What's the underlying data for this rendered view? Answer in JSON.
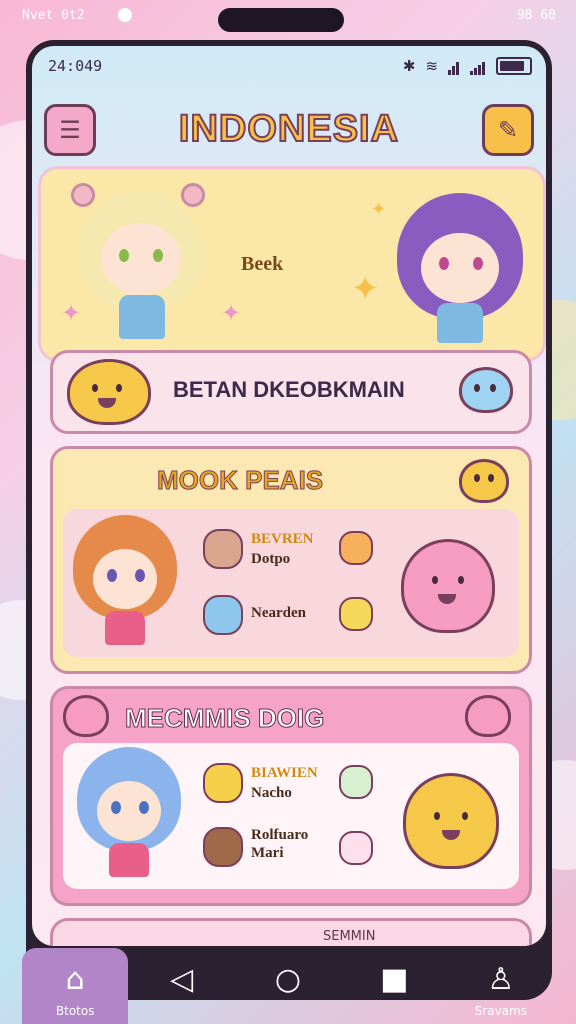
{
  "device": {
    "outer_status_left": "Nvet 0t2",
    "outer_status_right": "98 60"
  },
  "status_bar": {
    "time": "24:049"
  },
  "app_bar": {
    "title": "INDONESIA",
    "menu_icon": "menu-icon",
    "edit_icon": "edit-icon"
  },
  "hero": {
    "label": "Beek"
  },
  "banner": {
    "label": "BETAN DKEOBKMAIN"
  },
  "section1": {
    "title": "MOOK PEAIS",
    "items": [
      "BEVREN",
      "Dotpo",
      "Nearden"
    ]
  },
  "section2": {
    "title": "MECMMIS DOIG",
    "items": [
      "BIAWIEN",
      "Nacho",
      "Rolfuaro",
      "Mari"
    ]
  },
  "peek": {
    "label": "SEMMIN"
  },
  "bottom_nav": [
    {
      "label": "Btotos",
      "icon": "home-icon"
    },
    {
      "label": "",
      "icon": "back-icon"
    },
    {
      "label": "",
      "icon": "home-circle-icon"
    },
    {
      "label": "",
      "icon": "recents-icon"
    },
    {
      "label": "Sravams",
      "icon": "profile-icon"
    }
  ],
  "colors": {
    "accent": "#f6c049",
    "pink": "#f5a3c6",
    "purple": "#b285c8",
    "nav": "#2b2130"
  }
}
